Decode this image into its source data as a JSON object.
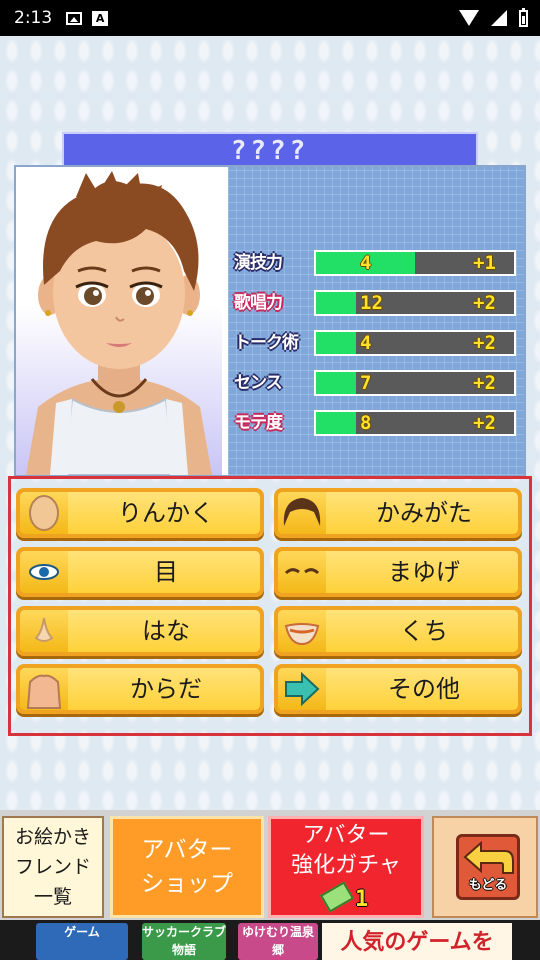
{
  "status_bar": {
    "time": "2:13"
  },
  "avatar": {
    "name": "????"
  },
  "stats": [
    {
      "label": "演技力",
      "value": "4",
      "bonus": "+1",
      "fill_fraction": 0.5,
      "label_color": "navy"
    },
    {
      "label": "歌唱力",
      "value": "12",
      "bonus": "+2",
      "fill_fraction": 0.2,
      "label_color": "pink"
    },
    {
      "label": "トーク術",
      "value": "4",
      "bonus": "+2",
      "fill_fraction": 0.2,
      "label_color": "navy"
    },
    {
      "label": "センス",
      "value": "7",
      "bonus": "+2",
      "fill_fraction": 0.2,
      "label_color": "navy"
    },
    {
      "label": "モテ度",
      "value": "8",
      "bonus": "+2",
      "fill_fraction": 0.2,
      "label_color": "pink"
    }
  ],
  "parts": [
    {
      "label": "りんかく",
      "icon": "face-outline-icon"
    },
    {
      "label": "かみがた",
      "icon": "hair-icon"
    },
    {
      "label": "目",
      "icon": "eye-icon"
    },
    {
      "label": "まゆげ",
      "icon": "eyebrow-icon"
    },
    {
      "label": "はな",
      "icon": "nose-icon"
    },
    {
      "label": "くち",
      "icon": "mouth-icon"
    },
    {
      "label": "からだ",
      "icon": "body-icon"
    },
    {
      "label": "その他",
      "icon": "arrow-right-icon"
    }
  ],
  "bottom": {
    "friend_line1": "お絵かき",
    "friend_line2": "フレンド",
    "friend_line3": "一覧",
    "shop_line1": "アバター",
    "shop_line2": "ショップ",
    "gacha_line1": "アバター",
    "gacha_line2": "強化ガチャ",
    "gacha_count": "1",
    "back_label": "もどる"
  },
  "ad": {
    "tile1": "ゲーム",
    "tile2": "サッカークラブ物語",
    "tile3": "ゆけむり温泉郷",
    "headline": "人気のゲームを"
  },
  "colors": {
    "name_bar": "#5b63e8",
    "stat_fill": "#22e066",
    "button_orange": "#f0a320",
    "selection_border": "#d8323a"
  }
}
